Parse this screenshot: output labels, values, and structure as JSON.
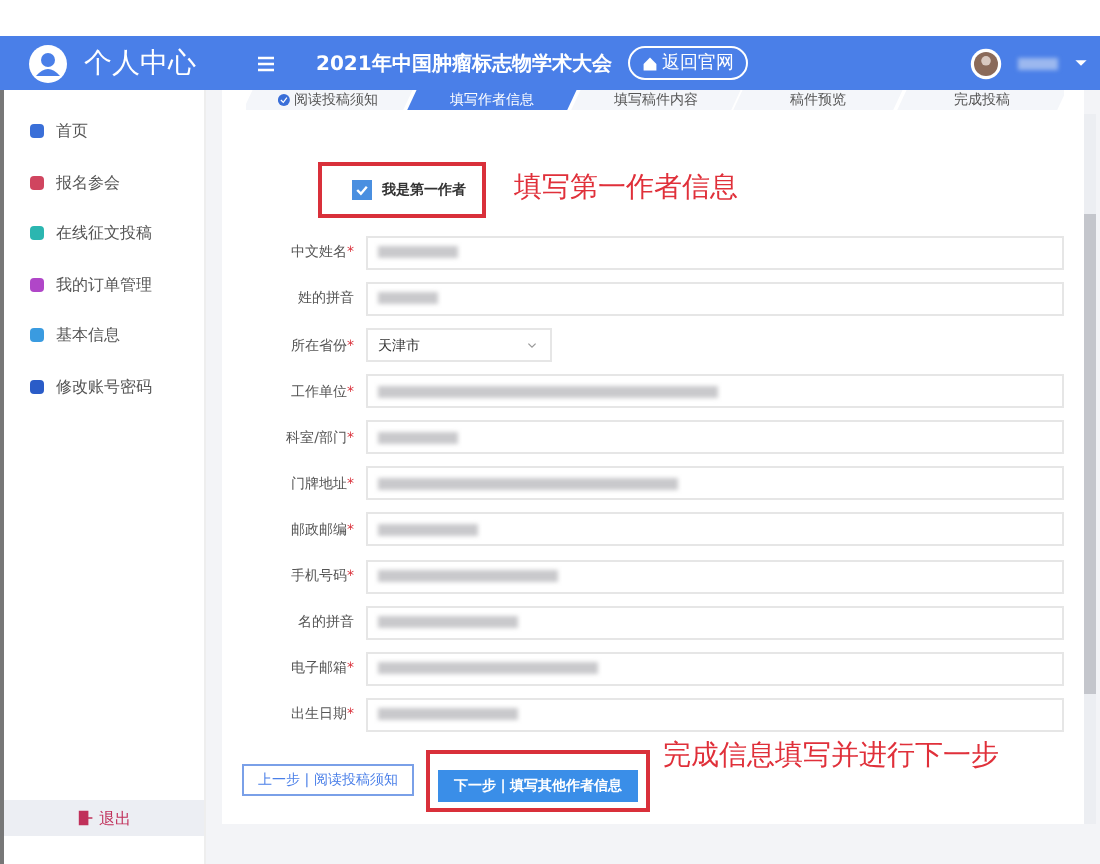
{
  "header": {
    "title": "个人中心",
    "conference": "2021年中国肿瘤标志物学术大会",
    "home_button": "返回官网"
  },
  "sidebar": {
    "items": [
      {
        "label": "首页",
        "color": "#3a6fd8",
        "selected": false
      },
      {
        "label": "报名参会",
        "color": "#d0455f",
        "selected": false
      },
      {
        "label": "在线征文投稿",
        "color": "#2bb6b0",
        "selected": false
      },
      {
        "label": "我的订单管理",
        "color": "#b046c8",
        "selected": false
      },
      {
        "label": "基本信息",
        "color": "#3a9be0",
        "selected": false
      },
      {
        "label": "修改账号密码",
        "color": "#2a5cc8",
        "selected": false
      }
    ],
    "logout": "退出"
  },
  "steps": [
    {
      "label": "阅读投稿须知",
      "done": true,
      "selected": false
    },
    {
      "label": "填写作者信息",
      "done": false,
      "selected": true
    },
    {
      "label": "填写稿件内容",
      "done": false,
      "selected": false
    },
    {
      "label": "稿件预览",
      "done": false,
      "selected": false
    },
    {
      "label": "完成投稿",
      "done": false,
      "selected": false
    }
  ],
  "first_author": {
    "label": "我是第一作者",
    "checked": true
  },
  "fields": [
    {
      "label": "中文姓名",
      "required": "*",
      "kind": "text",
      "blurred": true
    },
    {
      "label": "姓的拼音",
      "kind": "text",
      "blurred": true
    },
    {
      "label": "所在省份",
      "required": "*",
      "kind": "select",
      "value": "天津市"
    },
    {
      "label": "工作单位",
      "required": "*",
      "kind": "text",
      "blurred": true
    },
    {
      "label": "科室/部门",
      "required": "*",
      "kind": "text",
      "blurred": true
    },
    {
      "label": "门牌地址",
      "required": "*",
      "kind": "text",
      "blurred": true
    },
    {
      "label": "邮政邮编",
      "required": "*",
      "kind": "text",
      "blurred": true
    },
    {
      "label": "手机号码",
      "required": "*",
      "kind": "text",
      "blurred": true
    },
    {
      "label": "名的拼音",
      "kind": "text",
      "blurred": true
    },
    {
      "label": "电子邮箱",
      "required": "*",
      "kind": "text",
      "blurred": true
    },
    {
      "label": "出生日期",
      "required": "*",
      "kind": "text",
      "blurred": true
    }
  ],
  "buttons": {
    "prev": "上一步 | 阅读投稿须知",
    "next": "下一步 | 填写其他作者信息"
  },
  "annotations": [
    "填写第一作者信息",
    "完成信息填写并进行下一步"
  ]
}
